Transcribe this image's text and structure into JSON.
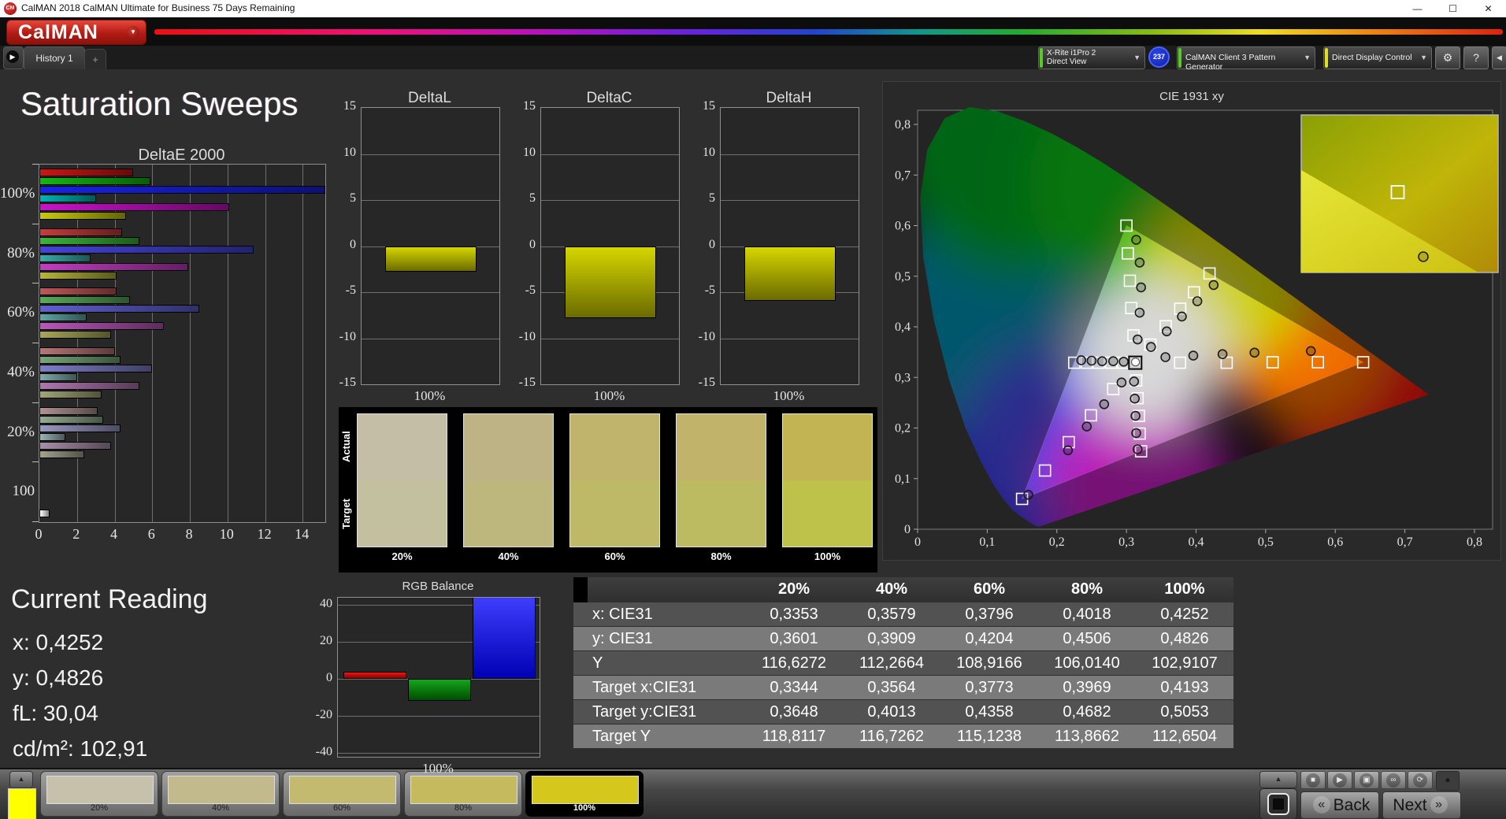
{
  "window": {
    "icon_label": "CM",
    "title": "CalMAN 2018 CalMAN Ultimate for Business 75 Days Remaining",
    "controls": {
      "minimize": "—",
      "maximize": "☐",
      "close": "✕"
    }
  },
  "logo": {
    "text": "CalMAN",
    "arrow": "▼"
  },
  "tabs": {
    "collapse_icon": "▶",
    "active": "History 1",
    "add_label": "+",
    "panel_icon": "◀"
  },
  "meters": {
    "device": {
      "line1": "X-Rite i1Pro 2",
      "line2": "Direct View",
      "accent": "#55cc22",
      "badge": "237",
      "arrow": "▼"
    },
    "pattern": {
      "label": "CalMAN Client 3 Pattern Generator",
      "accent": "#55cc22",
      "arrow": "▼"
    },
    "display": {
      "label": "Direct Display Control",
      "accent": "#e0e022",
      "arrow": "▼"
    },
    "settings_icon": "⚙",
    "help_icon": "?"
  },
  "page": {
    "title": "Saturation Sweeps"
  },
  "current_reading": {
    "title": "Current Reading",
    "items": [
      "x: 0,4252",
      "y: 0,4826",
      "fL: 30,04",
      "cd/m²: 102,91"
    ]
  },
  "swatch_panel": {
    "row_labels": [
      "Actual",
      "Target"
    ],
    "columns": [
      {
        "label": "20%",
        "actual": "#c4bea6",
        "target": "#c3c0a0"
      },
      {
        "label": "40%",
        "actual": "#bdb385",
        "target": "#bdb77e"
      },
      {
        "label": "60%",
        "actual": "#c0b46d",
        "target": "#bdb966"
      },
      {
        "label": "80%",
        "actual": "#c1b369",
        "target": "#bdbb62"
      },
      {
        "label": "100%",
        "actual": "#c2b452",
        "target": "#bfc24a"
      }
    ]
  },
  "table": {
    "columns": [
      "20%",
      "40%",
      "60%",
      "80%",
      "100%"
    ],
    "rows": [
      {
        "label": "x: CIE31",
        "values": [
          "0,3353",
          "0,3579",
          "0,3796",
          "0,4018",
          "0,4252"
        ]
      },
      {
        "label": "y: CIE31",
        "values": [
          "0,3601",
          "0,3909",
          "0,4204",
          "0,4506",
          "0,4826"
        ]
      },
      {
        "label": "Y",
        "values": [
          "116,6272",
          "112,2664",
          "108,9166",
          "106,0140",
          "102,9107"
        ]
      },
      {
        "label": "Target x:CIE31",
        "values": [
          "0,3344",
          "0,3564",
          "0,3773",
          "0,3969",
          "0,4193"
        ]
      },
      {
        "label": "Target y:CIE31",
        "values": [
          "0,3648",
          "0,4013",
          "0,4358",
          "0,4682",
          "0,5053"
        ]
      },
      {
        "label": "Target Y",
        "values": [
          "118,8117",
          "116,7262",
          "115,1238",
          "113,8662",
          "112,6504"
        ]
      }
    ]
  },
  "bottom_bar": {
    "up_icon": "▲",
    "current_patch_color": "#ffff00",
    "swatches": [
      {
        "label": "20%",
        "color": "#c6c1ab",
        "selected": false
      },
      {
        "label": "40%",
        "color": "#c2ba8c",
        "selected": false
      },
      {
        "label": "60%",
        "color": "#c3ba70",
        "selected": false
      },
      {
        "label": "80%",
        "color": "#c5bb5e",
        "selected": false
      },
      {
        "label": "100%",
        "color": "#d6c71c",
        "selected": true
      }
    ],
    "transport_icons": [
      {
        "name": "stop",
        "glyph": "■"
      },
      {
        "name": "play",
        "glyph": "▶"
      },
      {
        "name": "pattern-window",
        "glyph": "▣"
      },
      {
        "name": "continuous",
        "glyph": "∞"
      },
      {
        "name": "refresh",
        "glyph": "⟳"
      }
    ],
    "record_icon": "●",
    "back_icon": "«",
    "back_label": "Back",
    "next_label": "Next",
    "next_icon": "»"
  },
  "chart_data": [
    {
      "id": "deltaE2000",
      "type": "bar",
      "orientation": "horizontal",
      "title": "DeltaE 2000",
      "xlim": [
        0,
        15.2
      ],
      "xticks": [
        0,
        2,
        4,
        6,
        8,
        10,
        12,
        14
      ],
      "groups": [
        {
          "label": "100%",
          "bars": [
            {
              "name": "red",
              "color": "#d01414",
              "value": 5.0
            },
            {
              "name": "green",
              "color": "#14b814",
              "value": 5.9
            },
            {
              "name": "blue",
              "color": "#1822e6",
              "value": 15.2
            },
            {
              "name": "cyan",
              "color": "#00b4b4",
              "value": 3.0
            },
            {
              "name": "magenta",
              "color": "#cc10cc",
              "value": 10.1
            },
            {
              "name": "yellow",
              "color": "#c8c810",
              "value": 4.6
            }
          ]
        },
        {
          "label": "80%",
          "bars": [
            {
              "name": "red",
              "color": "#c83c3c",
              "value": 4.4
            },
            {
              "name": "green",
              "color": "#3cb43c",
              "value": 5.3
            },
            {
              "name": "blue",
              "color": "#4444dc",
              "value": 11.4
            },
            {
              "name": "cyan",
              "color": "#3cacac",
              "value": 2.7
            },
            {
              "name": "magenta",
              "color": "#c43cc4",
              "value": 7.9
            },
            {
              "name": "yellow",
              "color": "#b4b43c",
              "value": 4.1
            }
          ]
        },
        {
          "label": "60%",
          "bars": [
            {
              "name": "red",
              "color": "#c05858",
              "value": 4.1
            },
            {
              "name": "green",
              "color": "#58ac58",
              "value": 4.8
            },
            {
              "name": "blue",
              "color": "#6060d0",
              "value": 8.5
            },
            {
              "name": "cyan",
              "color": "#60a8a8",
              "value": 2.5
            },
            {
              "name": "magenta",
              "color": "#b858b8",
              "value": 6.6
            },
            {
              "name": "yellow",
              "color": "#a8a858",
              "value": 3.8
            }
          ]
        },
        {
          "label": "40%",
          "bars": [
            {
              "name": "red",
              "color": "#b87676",
              "value": 4.0
            },
            {
              "name": "green",
              "color": "#76a876",
              "value": 4.3
            },
            {
              "name": "blue",
              "color": "#7e7ec8",
              "value": 6.0
            },
            {
              "name": "cyan",
              "color": "#7eacac",
              "value": 2.0
            },
            {
              "name": "magenta",
              "color": "#b076b0",
              "value": 5.3
            },
            {
              "name": "yellow",
              "color": "#a4a476",
              "value": 3.3
            }
          ]
        },
        {
          "label": "20%",
          "bars": [
            {
              "name": "red",
              "color": "#b09292",
              "value": 3.1
            },
            {
              "name": "green",
              "color": "#92ac92",
              "value": 3.4
            },
            {
              "name": "blue",
              "color": "#9898c4",
              "value": 4.3
            },
            {
              "name": "cyan",
              "color": "#96b4b4",
              "value": 1.4
            },
            {
              "name": "magenta",
              "color": "#a890a8",
              "value": 3.8
            },
            {
              "name": "yellow",
              "color": "#a4a48e",
              "value": 2.4
            }
          ]
        },
        {
          "label": "100",
          "slot_offset": 5,
          "bars": [
            {
              "name": "white",
              "color": "#ffffff",
              "value": 0.55
            }
          ]
        }
      ]
    },
    {
      "id": "deltaL",
      "type": "bar",
      "title": "DeltaL",
      "ylim": [
        -15,
        15
      ],
      "yticks": [
        15,
        10,
        5,
        0,
        -5,
        -10,
        -15
      ],
      "xlabel": "100%",
      "value": -2.8,
      "color": "#d6d600"
    },
    {
      "id": "deltaC",
      "type": "bar",
      "title": "DeltaC",
      "ylim": [
        -15,
        15
      ],
      "yticks": [
        15,
        10,
        5,
        0,
        -5,
        -10,
        -15
      ],
      "xlabel": "100%",
      "value": -7.8,
      "color": "#d6d600"
    },
    {
      "id": "deltaH",
      "type": "bar",
      "title": "DeltaH",
      "ylim": [
        -15,
        15
      ],
      "yticks": [
        15,
        10,
        5,
        0,
        -5,
        -10,
        -15
      ],
      "xlabel": "100%",
      "value": -5.9,
      "color": "#d6d600"
    },
    {
      "id": "rgb_balance",
      "type": "bar",
      "title": "RGB Balance",
      "ylim": [
        -42,
        44
      ],
      "yticks": [
        40,
        20,
        0,
        -20,
        -40
      ],
      "xlabel": "100%",
      "bars": [
        {
          "name": "red",
          "value": 4,
          "color": "#ee1515",
          "color2": "#8c0000"
        },
        {
          "name": "green",
          "value": -12,
          "color": "#15a51c",
          "color2": "#004d00"
        },
        {
          "name": "blue",
          "value": 46,
          "color": "#4040ff",
          "color2": "#0000b4"
        }
      ]
    },
    {
      "id": "cie1931",
      "type": "scatter",
      "title": "CIE 1931 xy",
      "xlim": [
        0,
        0.826
      ],
      "ylim": [
        0,
        0.828
      ],
      "xticks": [
        "0",
        "0,1",
        "0,2",
        "0,3",
        "0,4",
        "0,5",
        "0,6",
        "0,7",
        "0,8"
      ],
      "yticks": [
        "0",
        "0,1",
        "0,2",
        "0,3",
        "0,4",
        "0,5",
        "0,6",
        "0,7",
        "0,8"
      ],
      "white_point": {
        "target": [
          0.3127,
          0.329
        ],
        "measured": [
          0.313,
          0.3305
        ]
      },
      "series": [
        {
          "name": "red",
          "color": "#cc2222",
          "target": [
            [
              0.377,
              0.329
            ],
            [
              0.444,
              0.329
            ],
            [
              0.51,
              0.33
            ],
            [
              0.575,
              0.33
            ],
            [
              0.64,
              0.33
            ]
          ],
          "measured": [
            [
              0.356,
              0.34
            ],
            [
              0.396,
              0.343
            ],
            [
              0.438,
              0.346
            ],
            [
              0.484,
              0.349
            ],
            [
              0.565,
              0.352
            ]
          ]
        },
        {
          "name": "green",
          "color": "#22bb22",
          "target": [
            [
              0.31,
              0.383
            ],
            [
              0.307,
              0.437
            ],
            [
              0.305,
              0.491
            ],
            [
              0.302,
              0.545
            ],
            [
              0.3,
              0.6
            ]
          ],
          "measured": [
            [
              0.316,
              0.375
            ],
            [
              0.319,
              0.428
            ],
            [
              0.321,
              0.478
            ],
            [
              0.319,
              0.527
            ],
            [
              0.314,
              0.572
            ]
          ]
        },
        {
          "name": "blue",
          "color": "#2233dd",
          "target": [
            [
              0.281,
              0.277
            ],
            [
              0.249,
              0.225
            ],
            [
              0.217,
              0.172
            ],
            [
              0.183,
              0.116
            ],
            [
              0.15,
              0.06
            ]
          ],
          "measured": [
            [
              0.293,
              0.29
            ],
            [
              0.268,
              0.247
            ],
            [
              0.243,
              0.203
            ],
            [
              0.216,
              0.156
            ],
            [
              0.159,
              0.068
            ]
          ]
        },
        {
          "name": "cyan",
          "color": "#22aaaa",
          "target": [
            [
              0.295,
              0.329
            ],
            [
              0.278,
              0.329
            ],
            [
              0.26,
              0.329
            ],
            [
              0.243,
              0.329
            ],
            [
              0.225,
              0.329
            ]
          ],
          "measured": [
            [
              0.296,
              0.331
            ],
            [
              0.281,
              0.332
            ],
            [
              0.265,
              0.332
            ],
            [
              0.25,
              0.333
            ],
            [
              0.235,
              0.334
            ]
          ]
        },
        {
          "name": "magenta",
          "color": "#bb22bb",
          "target": [
            [
              0.314,
              0.294
            ],
            [
              0.316,
              0.259
            ],
            [
              0.318,
              0.224
            ],
            [
              0.319,
              0.189
            ],
            [
              0.321,
              0.154
            ]
          ],
          "measured": [
            [
              0.311,
              0.292
            ],
            [
              0.312,
              0.258
            ],
            [
              0.313,
              0.224
            ],
            [
              0.314,
              0.19
            ],
            [
              0.316,
              0.158
            ]
          ]
        },
        {
          "name": "yellow",
          "color": "#bbbb22",
          "target": [
            [
              0.3344,
              0.3648
            ],
            [
              0.3564,
              0.4013
            ],
            [
              0.3773,
              0.4358
            ],
            [
              0.3969,
              0.4682
            ],
            [
              0.4193,
              0.5053
            ]
          ],
          "measured": [
            [
              0.3353,
              0.3601
            ],
            [
              0.3579,
              0.3909
            ],
            [
              0.3796,
              0.4204
            ],
            [
              0.4018,
              0.4506
            ],
            [
              0.4252,
              0.4826
            ]
          ]
        }
      ],
      "inset": {
        "square": [
          0.49,
          0.49
        ],
        "circle": [
          0.62,
          0.9
        ]
      }
    }
  ]
}
